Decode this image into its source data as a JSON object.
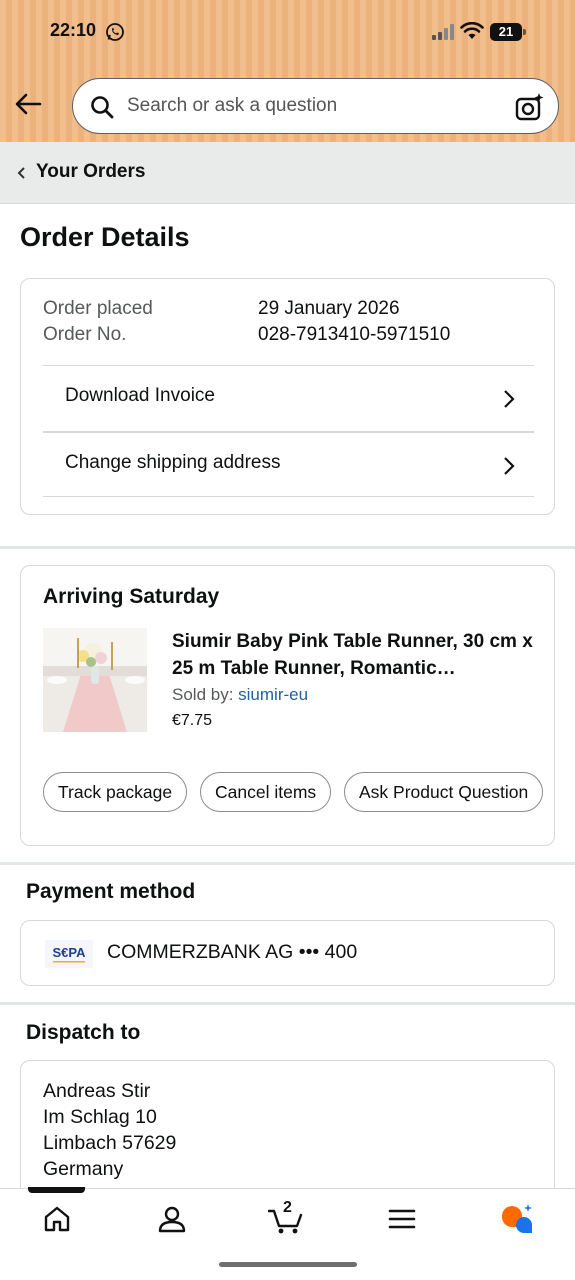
{
  "status_bar": {
    "time": "22:10",
    "battery": "21"
  },
  "search": {
    "placeholder": "Search or ask a question"
  },
  "breadcrumb": {
    "label": "Your Orders"
  },
  "page_title": "Order Details",
  "order_info": {
    "placed_label": "Order placed",
    "placed_value": "29 January 2026",
    "number_label": "Order No.",
    "number_value": "028-7913410-5971510",
    "actions": [
      "Download Invoice",
      "Change shipping address"
    ]
  },
  "shipment": {
    "heading": "Arriving Saturday",
    "product_title": "Siumir Baby Pink Table Runner, 30 cm x 25 m Table Runner, Romantic…",
    "sold_by_label": "Sold by: ",
    "seller": "siumir-eu",
    "price": "€7.75",
    "buttons": [
      "Track package",
      "Cancel items",
      "Ask Product Question"
    ]
  },
  "payment": {
    "heading": "Payment method",
    "logo_text": "SEPA",
    "bank": "COMMERZBANK AG ••• 400"
  },
  "dispatch": {
    "heading": "Dispatch to",
    "lines": [
      "Andreas Stir",
      "Im Schlag 10",
      "Limbach 57629",
      "Germany"
    ]
  },
  "tab_bar": {
    "cart_count": "2"
  },
  "colors": {
    "header_bg": "#f2be8c",
    "link": "#2162a1",
    "accent": "#ff6a00"
  }
}
